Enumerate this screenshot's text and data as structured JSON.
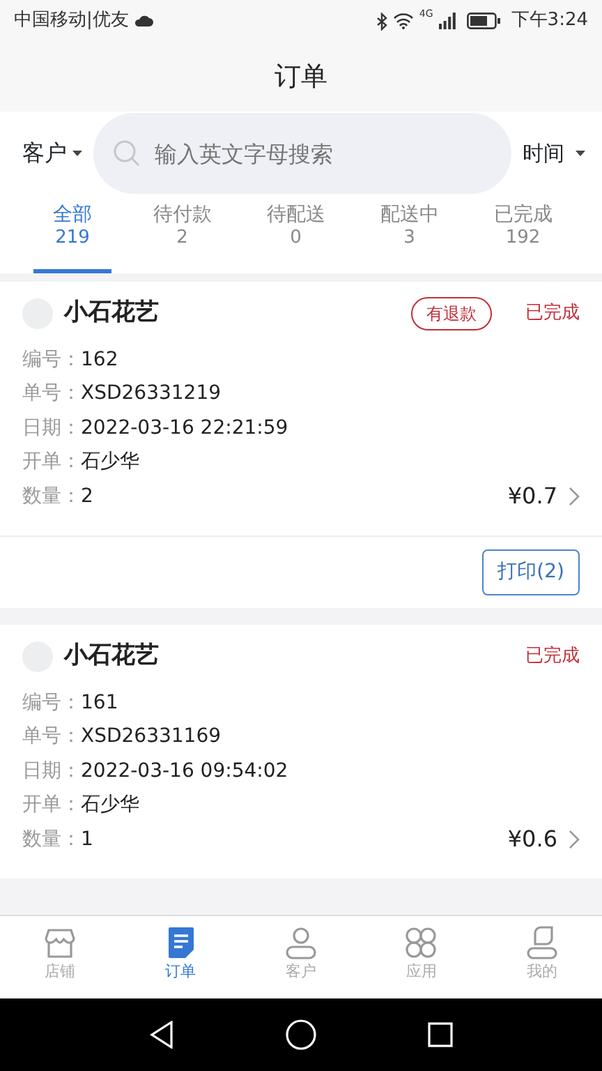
{
  "status_bar": {
    "carrier": "中国移动|优友",
    "network": "4G",
    "time": "下午3:24"
  },
  "title": "订单",
  "filters": {
    "customer": "客户",
    "search_placeholder": "输入英文字母搜索",
    "time": "时间"
  },
  "tabs": [
    {
      "label": "全部",
      "count": "219",
      "selected": true
    },
    {
      "label": "待付款",
      "count": "2",
      "selected": false
    },
    {
      "label": "待配送",
      "count": "0",
      "selected": false
    },
    {
      "label": "配送中",
      "count": "3",
      "selected": false
    },
    {
      "label": "已完成",
      "count": "192",
      "selected": false
    }
  ],
  "orders": [
    {
      "name": "小石花艺",
      "tag": "有退款",
      "status": "已完成",
      "fields": [
        {
          "label": "编号：",
          "value": "162"
        },
        {
          "label": "单号：",
          "value": "XSD26331219"
        },
        {
          "label": "日期：",
          "value": "2022-03-16 22:21:59"
        },
        {
          "label": "开单：",
          "value": "石少华"
        },
        {
          "label": "数量：",
          "value": "2"
        }
      ],
      "amount": "¥0.7",
      "print_button": "打印(2)"
    },
    {
      "name": "小石花艺",
      "status": "已完成",
      "fields": [
        {
          "label": "编号：",
          "value": "161"
        },
        {
          "label": "单号：",
          "value": "XSD26331169"
        },
        {
          "label": "日期：",
          "value": "2022-03-16 09:54:02"
        },
        {
          "label": "开单：",
          "value": "石少华"
        },
        {
          "label": "数量：",
          "value": "1"
        }
      ],
      "amount": "¥0.6"
    }
  ],
  "bottom_nav": [
    {
      "kind": "store",
      "label": "店铺",
      "selected": false
    },
    {
      "kind": "orders",
      "label": "订单",
      "selected": true
    },
    {
      "kind": "customer",
      "label": "客户",
      "selected": false
    },
    {
      "kind": "apps",
      "label": "应用",
      "selected": false
    },
    {
      "kind": "me",
      "label": "我的",
      "selected": false
    }
  ]
}
